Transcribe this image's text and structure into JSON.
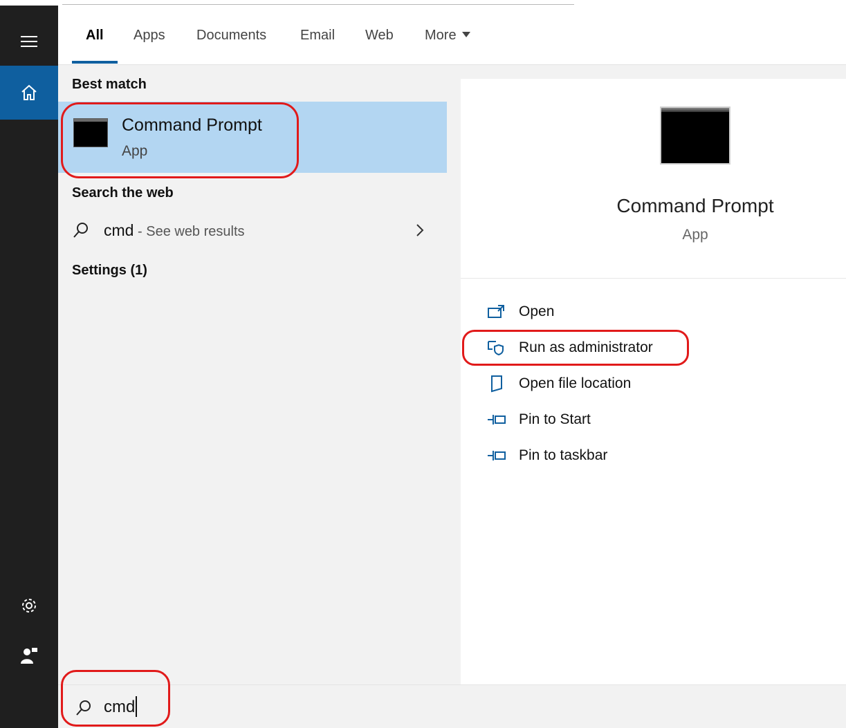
{
  "tabs": [
    {
      "label": "All",
      "active": true
    },
    {
      "label": "Apps",
      "active": false
    },
    {
      "label": "Documents",
      "active": false
    },
    {
      "label": "Email",
      "active": false
    },
    {
      "label": "Web",
      "active": false
    },
    {
      "label": "More",
      "active": false
    }
  ],
  "left": {
    "best_match_heading": "Best match",
    "best_match": {
      "title": "Command Prompt",
      "subtitle": "App"
    },
    "search_web_heading": "Search the web",
    "web_result": {
      "query": "cmd",
      "hint": " - See web results"
    },
    "settings_heading": "Settings (1)"
  },
  "right": {
    "app_title": "Command Prompt",
    "app_subtitle": "App",
    "actions": [
      {
        "label": "Open",
        "icon": "open-icon"
      },
      {
        "label": "Run as administrator",
        "icon": "shield-icon"
      },
      {
        "label": "Open file location",
        "icon": "file-location-icon"
      },
      {
        "label": "Pin to Start",
        "icon": "pin-icon"
      },
      {
        "label": "Pin to taskbar",
        "icon": "pin-icon"
      }
    ]
  },
  "search": {
    "value": "cmd"
  },
  "colors": {
    "accent": "#0f5f9f",
    "selected": "#b3d6f2",
    "annotation": "#e11a1a",
    "rail": "#1f1f1f"
  }
}
